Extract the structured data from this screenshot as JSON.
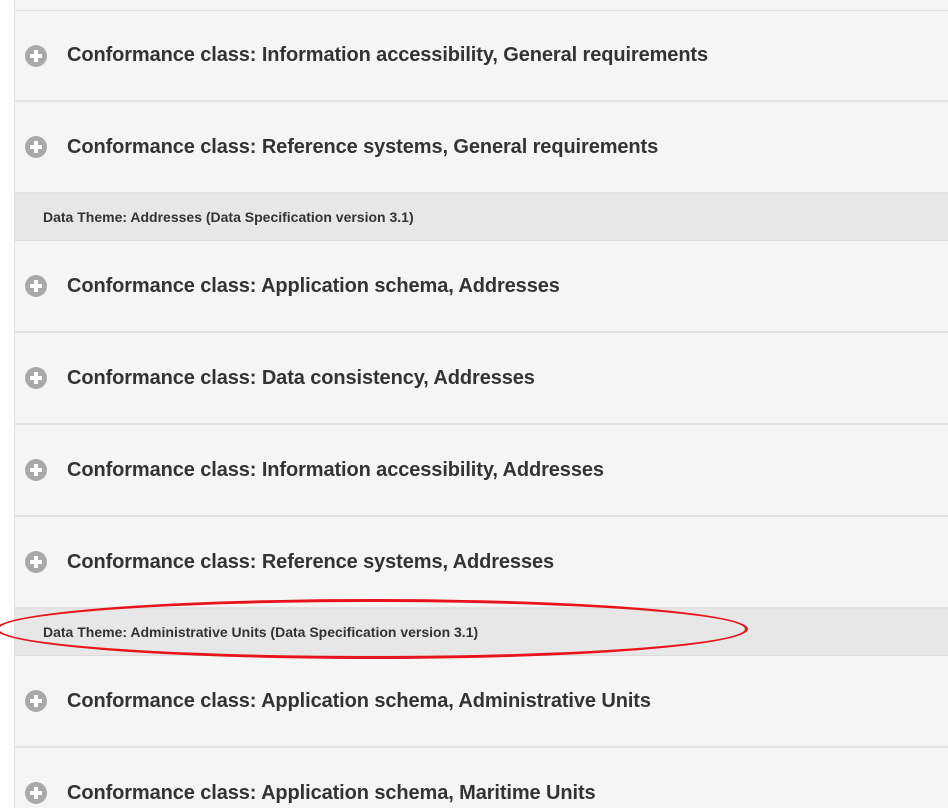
{
  "sections": [
    {
      "rows": [
        {
          "label": "Conformance class: Information accessibility, General requirements"
        },
        {
          "label": "Conformance class: Reference systems, General requirements"
        }
      ]
    },
    {
      "theme_header": "Data Theme: Addresses (Data Specification version 3.1)",
      "rows": [
        {
          "label": "Conformance class: Application schema, Addresses"
        },
        {
          "label": "Conformance class: Data consistency, Addresses"
        },
        {
          "label": "Conformance class: Information accessibility, Addresses"
        },
        {
          "label": "Conformance class: Reference systems, Addresses"
        }
      ]
    },
    {
      "theme_header": "Data Theme: Administrative Units (Data Specification version 3.1)",
      "rows": [
        {
          "label": "Conformance class: Application schema, Administrative Units"
        },
        {
          "label": "Conformance class: Application schema, Maritime Units"
        }
      ]
    }
  ],
  "annotation": {
    "color": "#e8141b"
  },
  "icons": {
    "expand": "plus-circle-icon"
  }
}
